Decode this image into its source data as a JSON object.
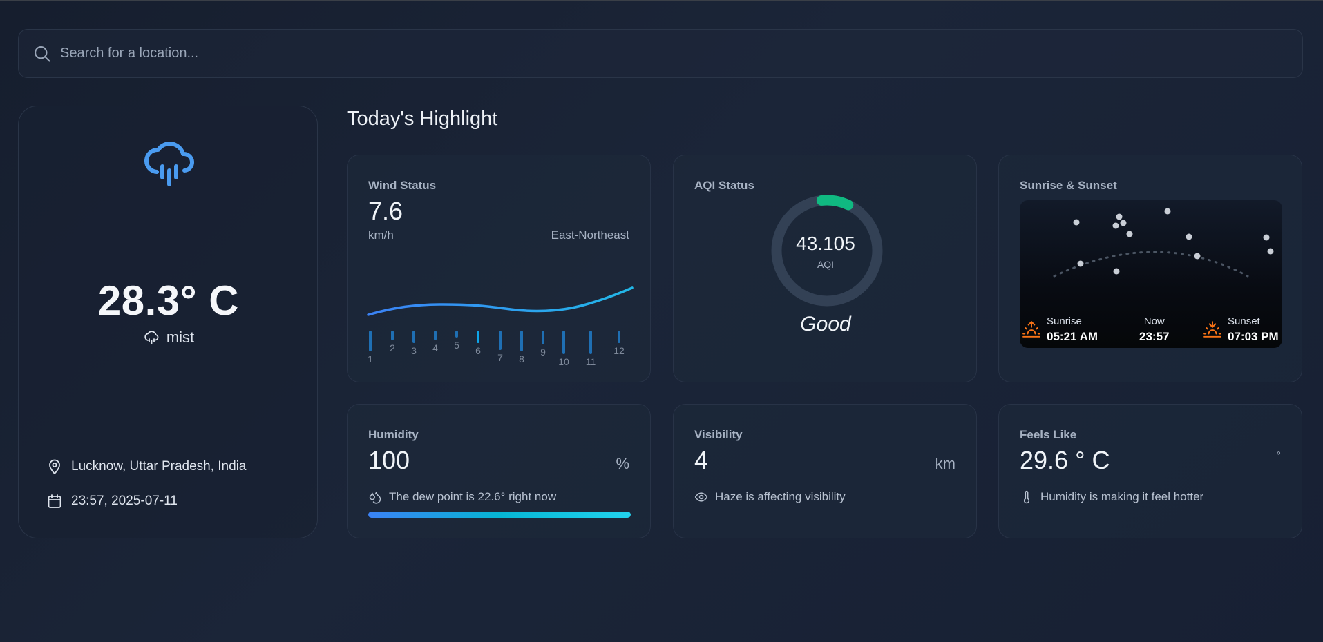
{
  "search": {
    "placeholder": "Search for a location..."
  },
  "current": {
    "icon": "cloud-rain-icon",
    "temperature": "28.3° C",
    "condition": "mist",
    "location": "Lucknow, Uttar Pradesh, India",
    "datetime": "23:57, 2025-07-11"
  },
  "highlights": {
    "title": "Today's Highlight",
    "wind": {
      "title": "Wind Status",
      "value": "7.6",
      "unit": "km/h",
      "direction": "East-Northeast",
      "hours": [
        "1",
        "2",
        "3",
        "4",
        "5",
        "6",
        "7",
        "8",
        "9",
        "10",
        "11",
        "12"
      ]
    },
    "aqi": {
      "title": "AQI Status",
      "value": "43.105",
      "label": "AQI",
      "status": "Good",
      "fraction": 0.086
    },
    "sun": {
      "title": "Sunrise & Sunset",
      "sunrise_label": "Sunrise",
      "sunrise": "05:21 AM",
      "now_label": "Now",
      "now": "23:57",
      "sunset_label": "Sunset",
      "sunset": "07:03 PM"
    },
    "humidity": {
      "title": "Humidity",
      "value": "100",
      "unit": "%",
      "note": "The dew point is 22.6° right now",
      "level": 100
    },
    "visibility": {
      "title": "Visibility",
      "value": "4",
      "unit": "km",
      "note": "Haze is affecting visibility"
    },
    "feels": {
      "title": "Feels Like",
      "value": "29.6 ° C",
      "unit": "°",
      "note": "Humidity is making it feel hotter"
    }
  },
  "colors": {
    "accent_blue": "#3b82f6",
    "aqi_good": "#10b981",
    "sun_orange": "#f97316"
  }
}
